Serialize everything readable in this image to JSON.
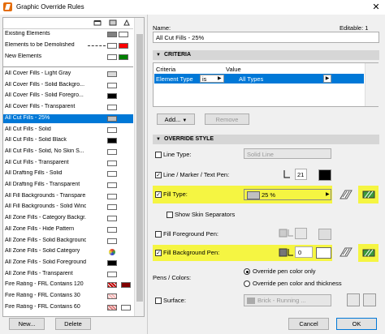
{
  "window": {
    "title": "Graphic Override Rules",
    "close_glyph": "✕",
    "minimize_glyph": "–",
    "maximize_glyph": "☐"
  },
  "left": {
    "special_rows": [
      {
        "label": "Existing Elements",
        "swatches": [
          "#808080",
          "#ffffff"
        ]
      },
      {
        "label": "Elements to be Demolished",
        "swatches": [
          "#ffffff",
          "#ff0000"
        ]
      },
      {
        "label": "New Elements",
        "swatches": [
          "#ffffff",
          "#008000"
        ]
      }
    ],
    "rules": [
      {
        "label": "All Cover Fills - Light Gray",
        "swatch": "#d9d9d9"
      },
      {
        "label": "All Cover Fills - Solid Backgro...",
        "swatch": "#ffffff"
      },
      {
        "label": "All Cover Fills - Solid Foregro...",
        "swatch": "#000000"
      },
      {
        "label": "All Cover Fills - Transparent",
        "swatch": "#ffffff"
      },
      {
        "label": "All Cut Fills - 25%",
        "swatch": "#c0c0c0"
      },
      {
        "label": "All Cut Fills - Solid",
        "swatch": "#ffffff"
      },
      {
        "label": "All Cut Fills - Solid Black",
        "swatch": "#000000"
      },
      {
        "label": "All Cut Fills - Solid, No Skin S...",
        "swatch": "#ffffff"
      },
      {
        "label": "All Cut Fills - Transparent",
        "swatch": "#ffffff"
      },
      {
        "label": "All Drafting Fills - Solid",
        "swatch": "#ffffff"
      },
      {
        "label": "All Drafting Fills - Transparent",
        "swatch": "#ffffff"
      },
      {
        "label": "All Fill Backgrounds - Transpare...",
        "swatch": "#ffffff"
      },
      {
        "label": "All Fill Backgrounds - Solid Wind...",
        "swatch": "#ffffff"
      },
      {
        "label": "All Zone Fills - Category Backgr...",
        "swatch": "#ffffff"
      },
      {
        "label": "All Zone Fills - Hide Pattern",
        "swatch": "#ffffff"
      },
      {
        "label": "All Zone Fills - Solid Background",
        "swatch": "#ffffff"
      },
      {
        "label": "All Zone Fills - Solid Category",
        "swatch": "multicolor"
      },
      {
        "label": "All Zone Fills - Solid Foreground",
        "swatch": "#000000"
      },
      {
        "label": "All Zone Fills - Transparent",
        "swatch": "#ffffff"
      },
      {
        "label": "Fire Rating - FRL Contains 120",
        "swatch": "#c00000",
        "swatch2": "#800000"
      },
      {
        "label": "Fire Rating - FRL Contains 30",
        "swatch": "#f4b6b6"
      },
      {
        "label": "Fire Rating - FRL Contains 60",
        "swatch": "#e08080",
        "swatch2": "#ffffff"
      }
    ],
    "selected_index": 4,
    "new_button": "New...",
    "delete_button": "Delete"
  },
  "right": {
    "name_label": "Name:",
    "editable_label": "Editable: 1",
    "name_value": "All Cut Fills - 25%",
    "criteria": {
      "section_title": "CRITERIA",
      "col_criteria": "Criteria",
      "col_value": "Value",
      "row": {
        "criteria": "Element Type",
        "operator": "is",
        "value": "All Types"
      },
      "add_button": "Add...",
      "remove_button": "Remove"
    },
    "override": {
      "section_title": "OVERRIDE STYLE",
      "line_type": {
        "label": "Line Type:",
        "value": "Solid Line",
        "checked": false
      },
      "line_pen": {
        "label": "Line / Marker / Text Pen:",
        "value": "21",
        "checked": true
      },
      "fill_type": {
        "label": "Fill Type:",
        "value": "25 %",
        "checked": true
      },
      "show_skin": {
        "label": "Show Skin Separators",
        "checked": false
      },
      "fill_fg_pen": {
        "label": "Fill Foreground Pen:",
        "checked": false
      },
      "fill_bg_pen": {
        "label": "Fill Background Pen:",
        "value": "0",
        "checked": true
      },
      "pens_colors_label": "Pens / Colors:",
      "radio_1": "Override pen color only",
      "radio_2": "Override pen color and thickness",
      "surface": {
        "label": "Surface:",
        "value": "Brick - Running ...",
        "checked": false
      }
    },
    "cancel_button": "Cancel",
    "ok_button": "OK"
  },
  "colors": {
    "highlight": "#f5f542",
    "selection": "#0078d7",
    "accent_green": "#3c9a3c"
  }
}
